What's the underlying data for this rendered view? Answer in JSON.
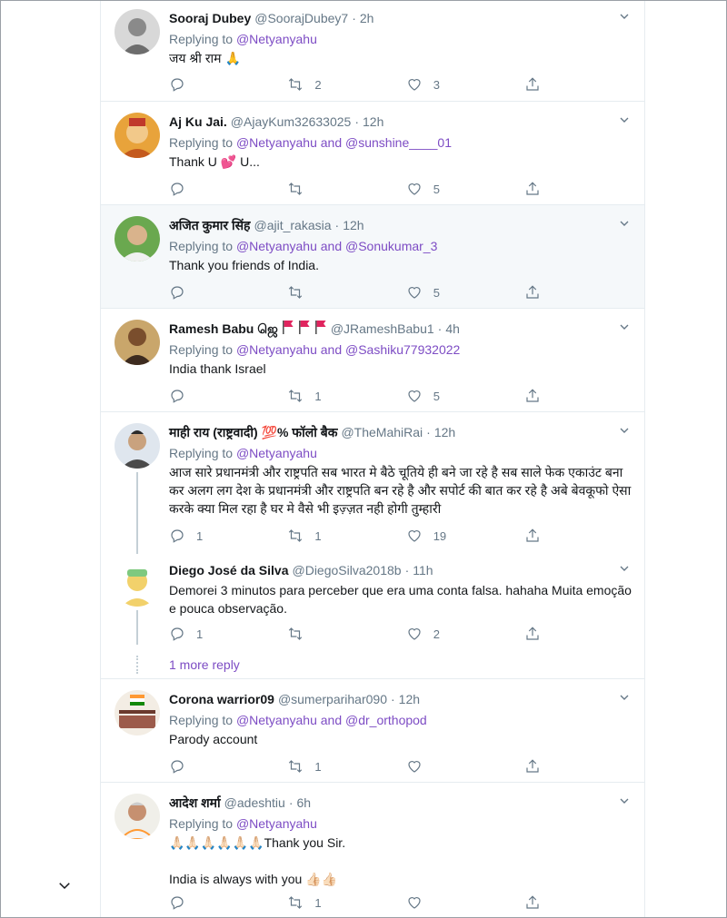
{
  "tweets": [
    {
      "name": "Sooraj Dubey",
      "handle": "@SoorajDubey7",
      "time": "2h",
      "reply_prefix": "Replying to",
      "reply_to": "@Netyanyahu",
      "text": "जय श्री राम 🙏",
      "reply_count": "",
      "retweet_count": "2",
      "like_count": "3"
    },
    {
      "name": "Aj Ku Jai.",
      "handle": "@AjayKum32633025",
      "time": "12h",
      "reply_prefix": "Replying to",
      "reply_to": "@Netyanyahu and @sunshine____01",
      "text": "Thank U 💕 U...",
      "reply_count": "",
      "retweet_count": "",
      "like_count": "5"
    },
    {
      "name": "अजित कुमार सिंह",
      "handle": "@ajit_rakasia",
      "time": "12h",
      "reply_prefix": "Replying to",
      "reply_to": "@Netyanyahu and @Sonukumar_3",
      "text": "Thank you friends of India.",
      "reply_count": "",
      "retweet_count": "",
      "like_count": "5"
    },
    {
      "name": "Ramesh Babu ஜெ",
      "handle": "@JRameshBabu1",
      "time": "4h",
      "reply_prefix": "Replying to",
      "reply_to": "@Netyanyahu and @Sashiku77932022",
      "text": "India thank Israel",
      "reply_count": "",
      "retweet_count": "1",
      "like_count": "5"
    },
    {
      "name": "माही राय (राष्ट्रवादी) 💯% फॉलो बैक",
      "handle": "@TheMahiRai",
      "time": "12h",
      "reply_prefix": "Replying to",
      "reply_to": "@Netyanyahu",
      "text": "आज सारे प्रधानमंत्री और राष्ट्रपति सब भारत मे बैठे चूतिये ही बने जा रहे है सब साले फेक एकाउंट बना कर अलग लग देश के प्रधानमंत्री और राष्ट्रपति बन रहे है और सपोर्ट की बात कर रहे है अबे बेवकूफो ऐसा करके क्या मिल रहा है घर मे वैसे भी इज़्ज़त नही होगी तुम्हारी",
      "reply_count": "1",
      "retweet_count": "1",
      "like_count": "19"
    },
    {
      "name": "Diego José da Silva",
      "handle": "@DiegoSilva2018b",
      "time": "11h",
      "reply_prefix": "",
      "reply_to": "",
      "text": "Demorei 3 minutos para perceber que era uma conta falsa. hahaha Muita emoção e pouca observação.",
      "reply_count": "1",
      "retweet_count": "",
      "like_count": "2"
    },
    {
      "name": "Corona warrior09",
      "handle": "@sumerparihar090",
      "time": "12h",
      "reply_prefix": "Replying to",
      "reply_to": "@Netyanyahu and @dr_orthopod",
      "text": "Parody account",
      "reply_count": "",
      "retweet_count": "1",
      "like_count": ""
    },
    {
      "name": "आदेश शर्मा",
      "handle": "@adeshtiu",
      "time": "6h",
      "reply_prefix": "Replying to",
      "reply_to": "@Netyanyahu",
      "text": "🙏🏻🙏🏻🙏🏻🙏🏻🙏🏻🙏🏻Thank you Sir.",
      "text2": "India is always with you 👍🏻👍🏻",
      "reply_count": "",
      "retweet_count": "1",
      "like_count": ""
    }
  ],
  "more_replies_label": "1 more reply",
  "icons": {
    "reply": "reply-icon",
    "retweet": "retweet-icon",
    "like": "heart-icon",
    "share": "share-icon",
    "more": "chevron-down-icon"
  },
  "colors": {
    "link": "#7d4cc4",
    "secondary": "#657786",
    "border": "#e6ecf0",
    "highlight": "#f5f8fa"
  }
}
